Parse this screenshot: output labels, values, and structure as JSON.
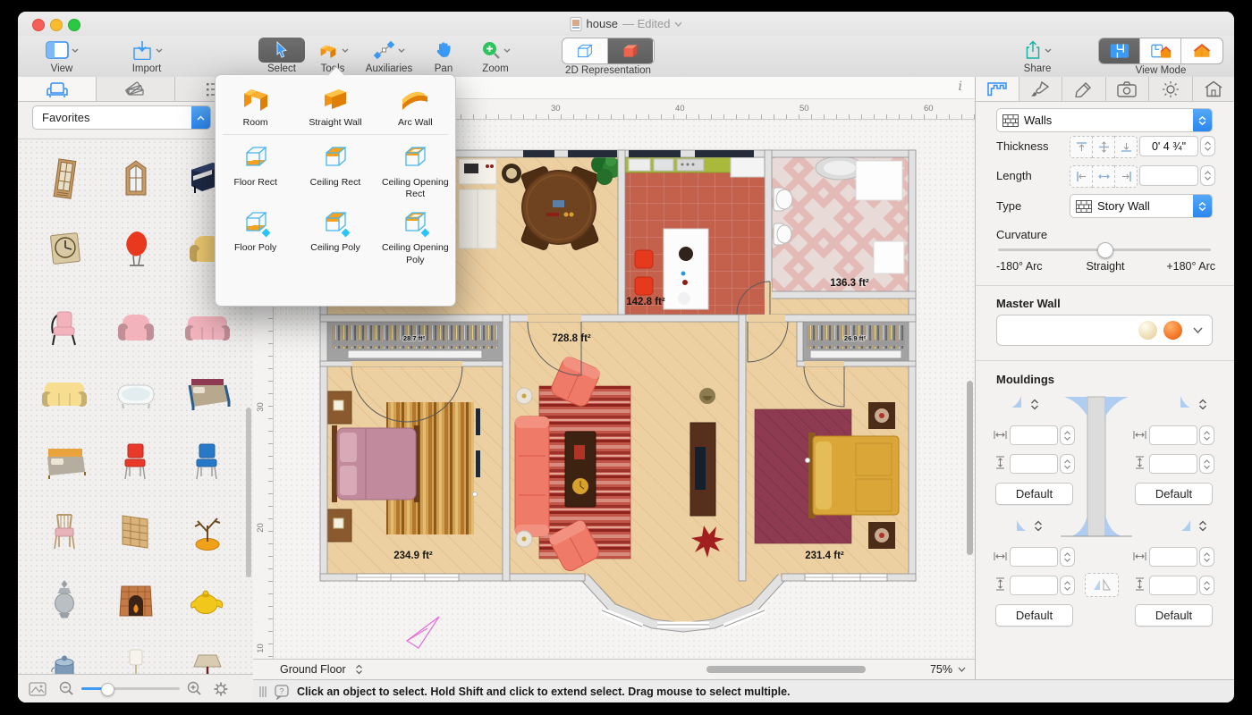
{
  "titlebar": {
    "doc_title": "house",
    "edited_suffix": "— Edited"
  },
  "toolbar": {
    "view": "View",
    "import": "Import",
    "select": "Select",
    "tools": "Tools",
    "auxiliaries": "Auxiliaries",
    "pan": "Pan",
    "zoom": "Zoom",
    "representation": "2D Representation",
    "share": "Share",
    "view_mode": "View Mode"
  },
  "tools_popup": {
    "items": [
      {
        "label": "Room",
        "kind": "room"
      },
      {
        "label": "Straight Wall",
        "kind": "straight-wall"
      },
      {
        "label": "Arc Wall",
        "kind": "arc-wall"
      },
      {
        "label": "Floor Rect",
        "kind": "floor-rect"
      },
      {
        "label": "Ceiling Rect",
        "kind": "ceiling-rect"
      },
      {
        "label": "Ceiling Opening Rect",
        "kind": "ceiling-opening-rect"
      },
      {
        "label": "Floor Poly",
        "kind": "floor-poly"
      },
      {
        "label": "Ceiling Poly",
        "kind": "ceiling-poly"
      },
      {
        "label": "Ceiling Opening Poly",
        "kind": "ceiling-opening-poly"
      }
    ]
  },
  "library": {
    "category": "Favorites",
    "items": [
      {
        "name": "door",
        "kind": "door",
        "color": "#c59a66"
      },
      {
        "name": "window",
        "kind": "window",
        "color": "#c59a66"
      },
      {
        "name": "piano",
        "kind": "piano",
        "color": "#1e2a46"
      },
      {
        "name": "wall-clock",
        "kind": "clock",
        "color": "#d9c9a4"
      },
      {
        "name": "egg-chair",
        "kind": "egg-chair",
        "color": "#e8391f"
      },
      {
        "name": "armchair-yellow",
        "kind": "armchair",
        "color": "#f0cb72"
      },
      {
        "name": "chair-pink-metal",
        "kind": "chair-metal",
        "color": "#f2b3bd"
      },
      {
        "name": "armchair-pink",
        "kind": "armchair",
        "color": "#f2b3bd"
      },
      {
        "name": "sofa-pink",
        "kind": "sofa",
        "color": "#f2b3bd"
      },
      {
        "name": "sofa-yellow",
        "kind": "sofa",
        "color": "#f7dd8f"
      },
      {
        "name": "bathtub",
        "kind": "bathtub",
        "color": "#f4f6f6"
      },
      {
        "name": "bed-blue",
        "kind": "bed",
        "color": "#2b5d8c"
      },
      {
        "name": "bed-orange",
        "kind": "bed2",
        "color": "#e8a33d"
      },
      {
        "name": "chair-red",
        "kind": "chair",
        "color": "#e8392a"
      },
      {
        "name": "chair-blue",
        "kind": "chair",
        "color": "#2878c8"
      },
      {
        "name": "chair-wood-pink",
        "kind": "chair-wood",
        "color": "#d9b98c"
      },
      {
        "name": "shelving-unit",
        "kind": "shelf",
        "color": "#d9b27c"
      },
      {
        "name": "bonsai-tree",
        "kind": "bonsai",
        "color": "#f0a11a"
      },
      {
        "name": "silver-urn",
        "kind": "urn",
        "color": "#b9bfc2"
      },
      {
        "name": "fireplace",
        "kind": "fireplace",
        "color": "#c67a45"
      },
      {
        "name": "teapot",
        "kind": "teapot",
        "color": "#f2c71c"
      },
      {
        "name": "pot-blue",
        "kind": "pot",
        "color": "#7d9bb8"
      },
      {
        "name": "floor-lamp",
        "kind": "floor-lamp",
        "color": "#f5f2ea"
      },
      {
        "name": "table-lamp",
        "kind": "table-lamp",
        "color": "#d8cbb2"
      }
    ]
  },
  "canvas": {
    "ruler_top_labels": [
      "30",
      "40",
      "50",
      "60"
    ],
    "ruler_left_labels": [
      "30",
      "20",
      "10"
    ],
    "info_icon": "i",
    "rooms": {
      "living_area": "728.8 ft²",
      "kitchen_area": "142.8 ft²",
      "bathroom_area": "136.3 ft²",
      "bedroom_left_area": "234.9 ft²",
      "bedroom_right_area": "231.4 ft²",
      "closet_left_area": "28.7 ft²",
      "closet_right_area": "26.9 ft²"
    },
    "floor_selector": "Ground Floor",
    "zoom_level": "75%"
  },
  "inspector": {
    "category_selector": "Walls",
    "thickness_label": "Thickness",
    "thickness_value": "0' 4 ¾\"",
    "length_label": "Length",
    "length_value": "",
    "type_label": "Type",
    "type_value": "Story Wall",
    "curvature_label": "Curvature",
    "curvature_left": "-180° Arc",
    "curvature_center": "Straight",
    "curvature_right": "+180° Arc",
    "master_wall_label": "Master Wall",
    "mouldings_label": "Mouldings",
    "default_button": "Default"
  },
  "statusbar": {
    "message": "Click an object to select. Hold Shift and click to extend select. Drag mouse to select multiple."
  },
  "colors": {
    "accent_blue": "#2f8df4",
    "selection_dark": "#636363",
    "tool_orange": "#f29111",
    "share_teal": "#16b2a4",
    "wood_floor": "#ecd0a2",
    "kitchen_floor": "#c4614d",
    "bath_floor": "#e8dad6",
    "closet_gray": "#a3a3a3",
    "rug_red": "#c05548",
    "rug_maroon": "#8e3b52",
    "bed_pink": "#c28b9d",
    "bed_gold": "#d9a637",
    "sofa_red": "#ef7a68"
  }
}
